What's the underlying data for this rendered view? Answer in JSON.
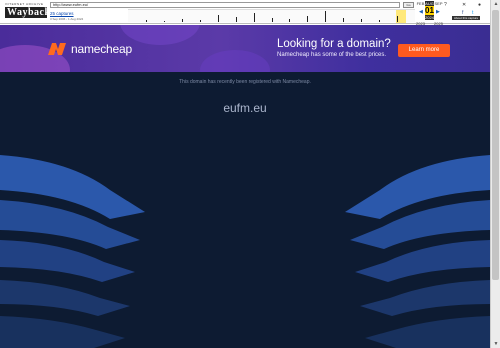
{
  "wayback": {
    "logo_tagline": "INTERNET ARCHIVE",
    "logo_brand": "WaybackMachine",
    "url_value": "http://www.eufm.eu/",
    "go_label": "Go",
    "captures": "25 captures",
    "date_range": "3 Sep 2006 - 1 Aug 2024",
    "months": {
      "prev": "FEB",
      "current": "AUG",
      "next": "SEP"
    },
    "day": "01",
    "years": {
      "prev": "2023",
      "current": "2024",
      "next": "2025"
    },
    "about_label": "About this capture",
    "sparkline": [
      2,
      1,
      3,
      2,
      7,
      5,
      9,
      4,
      3,
      6,
      11,
      4,
      3,
      2,
      6
    ]
  },
  "banner": {
    "brand": "namecheap",
    "headline": "Looking for a domain?",
    "subline": "Namecheap has some of the best prices.",
    "cta": "Learn more",
    "colors": {
      "accent": "#ff5a1f",
      "bg": "#4a2c9a"
    }
  },
  "main": {
    "notice": "This domain has recently been registered with Namecheap.",
    "domain": "eufm.eu",
    "colors": {
      "bg": "#0d1b32",
      "wave": "#2f5fb8"
    }
  }
}
